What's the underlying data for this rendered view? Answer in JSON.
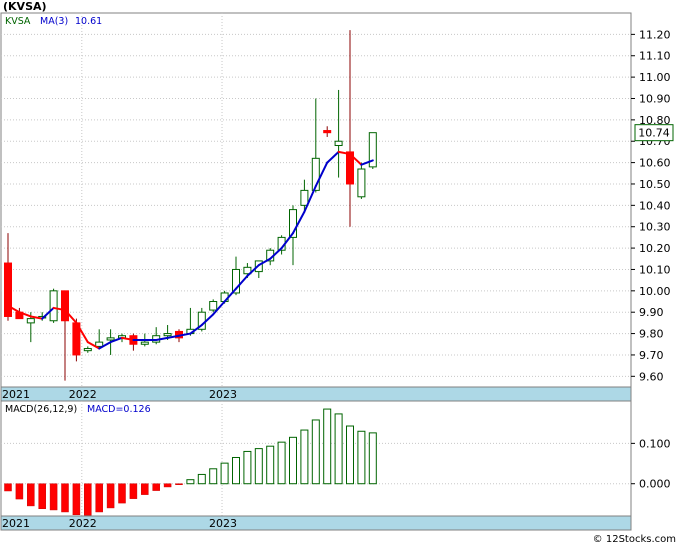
{
  "header": {
    "title": "(KVSA)",
    "watermark": "© 12Stocks.com"
  },
  "colors": {
    "bull": "#006400",
    "bear": "#ff0000",
    "ma_up": "#0000cc",
    "ma_down": "#ff0000",
    "band": "#add8e6",
    "grid": "#c8c8c8",
    "last_box": "#006400"
  },
  "chart_data": [
    {
      "type": "candlestick",
      "legend": {
        "symbol": "KVSA",
        "ma_label": "MA(3)",
        "ma_value": "10.61"
      },
      "time_labels": [
        "2021",
        "2022",
        "2023"
      ],
      "last_price_label": "10.74",
      "ylim": [
        9.55,
        11.3
      ],
      "y_ticks": [
        "11.20",
        "11.10",
        "11.00",
        "10.90",
        "10.80",
        "10.70",
        "10.60",
        "10.50",
        "10.40",
        "10.30",
        "10.20",
        "10.10",
        "10.00",
        "9.90",
        "9.80",
        "9.70",
        "9.60"
      ],
      "candles": [
        {
          "o": 10.13,
          "h": 10.27,
          "l": 9.86,
          "c": 9.88
        },
        {
          "o": 9.9,
          "h": 9.92,
          "l": 9.87,
          "c": 9.87
        },
        {
          "o": 9.85,
          "h": 9.9,
          "l": 9.76,
          "c": 9.87
        },
        {
          "o": 9.88,
          "h": 9.9,
          "l": 9.86,
          "c": 9.88
        },
        {
          "o": 9.86,
          "h": 10.01,
          "l": 9.85,
          "c": 10.0
        },
        {
          "o": 10.0,
          "h": 10.0,
          "l": 9.58,
          "c": 9.86
        },
        {
          "o": 9.85,
          "h": 9.87,
          "l": 9.67,
          "c": 9.7
        },
        {
          "o": 9.72,
          "h": 9.74,
          "l": 9.71,
          "c": 9.73
        },
        {
          "o": 9.74,
          "h": 9.82,
          "l": 9.73,
          "c": 9.76
        },
        {
          "o": 9.77,
          "h": 9.82,
          "l": 9.7,
          "c": 9.78
        },
        {
          "o": 9.78,
          "h": 9.8,
          "l": 9.76,
          "c": 9.79
        },
        {
          "o": 9.79,
          "h": 9.8,
          "l": 9.72,
          "c": 9.75
        },
        {
          "o": 9.75,
          "h": 9.8,
          "l": 9.74,
          "c": 9.76
        },
        {
          "o": 9.76,
          "h": 9.83,
          "l": 9.75,
          "c": 9.79
        },
        {
          "o": 9.79,
          "h": 9.84,
          "l": 9.77,
          "c": 9.8
        },
        {
          "o": 9.81,
          "h": 9.82,
          "l": 9.76,
          "c": 9.78
        },
        {
          "o": 9.8,
          "h": 9.92,
          "l": 9.79,
          "c": 9.82
        },
        {
          "o": 9.82,
          "h": 9.92,
          "l": 9.81,
          "c": 9.9
        },
        {
          "o": 9.91,
          "h": 9.96,
          "l": 9.9,
          "c": 9.95
        },
        {
          "o": 9.95,
          "h": 10.0,
          "l": 9.94,
          "c": 9.99
        },
        {
          "o": 9.99,
          "h": 10.16,
          "l": 9.98,
          "c": 10.1
        },
        {
          "o": 10.08,
          "h": 10.13,
          "l": 10.06,
          "c": 10.11
        },
        {
          "o": 10.09,
          "h": 10.14,
          "l": 10.06,
          "c": 10.14
        },
        {
          "o": 10.14,
          "h": 10.2,
          "l": 10.12,
          "c": 10.19
        },
        {
          "o": 10.19,
          "h": 10.26,
          "l": 10.17,
          "c": 10.25
        },
        {
          "o": 10.25,
          "h": 10.4,
          "l": 10.12,
          "c": 10.38
        },
        {
          "o": 10.4,
          "h": 10.52,
          "l": 10.37,
          "c": 10.47
        },
        {
          "o": 10.47,
          "h": 10.9,
          "l": 10.46,
          "c": 10.62
        },
        {
          "o": 10.75,
          "h": 10.77,
          "l": 10.72,
          "c": 10.74
        },
        {
          "o": 10.68,
          "h": 10.94,
          "l": 10.53,
          "c": 10.7
        },
        {
          "o": 10.65,
          "h": 11.22,
          "l": 10.3,
          "c": 10.5
        },
        {
          "o": 10.44,
          "h": 10.6,
          "l": 10.43,
          "c": 10.57
        },
        {
          "o": 10.58,
          "h": 10.74,
          "l": 10.57,
          "c": 10.74
        }
      ],
      "ma": [
        9.93,
        9.9,
        9.88,
        9.87,
        9.92,
        9.91,
        9.85,
        9.76,
        9.73,
        9.76,
        9.78,
        9.77,
        9.77,
        9.77,
        9.78,
        9.79,
        9.8,
        9.84,
        9.89,
        9.95,
        10.01,
        10.07,
        10.12,
        10.15,
        10.2,
        10.27,
        10.37,
        10.49,
        10.6,
        10.65,
        10.64,
        10.59,
        10.61
      ]
    },
    {
      "type": "bar",
      "legend": {
        "name": "MACD(26,12,9)",
        "value_label": "MACD=0.126"
      },
      "time_labels": [
        "2021",
        "2022",
        "2023"
      ],
      "ylim": [
        -0.08,
        0.205
      ],
      "y_ticks": [
        "0.100",
        "0.000"
      ],
      "values": [
        -0.018,
        -0.038,
        -0.055,
        -0.062,
        -0.065,
        -0.07,
        -0.077,
        -0.078,
        -0.07,
        -0.06,
        -0.048,
        -0.037,
        -0.027,
        -0.017,
        -0.008,
        -0.002,
        0.01,
        0.023,
        0.037,
        0.051,
        0.065,
        0.08,
        0.087,
        0.093,
        0.103,
        0.115,
        0.133,
        0.158,
        0.185,
        0.173,
        0.143,
        0.13,
        0.126
      ]
    }
  ]
}
